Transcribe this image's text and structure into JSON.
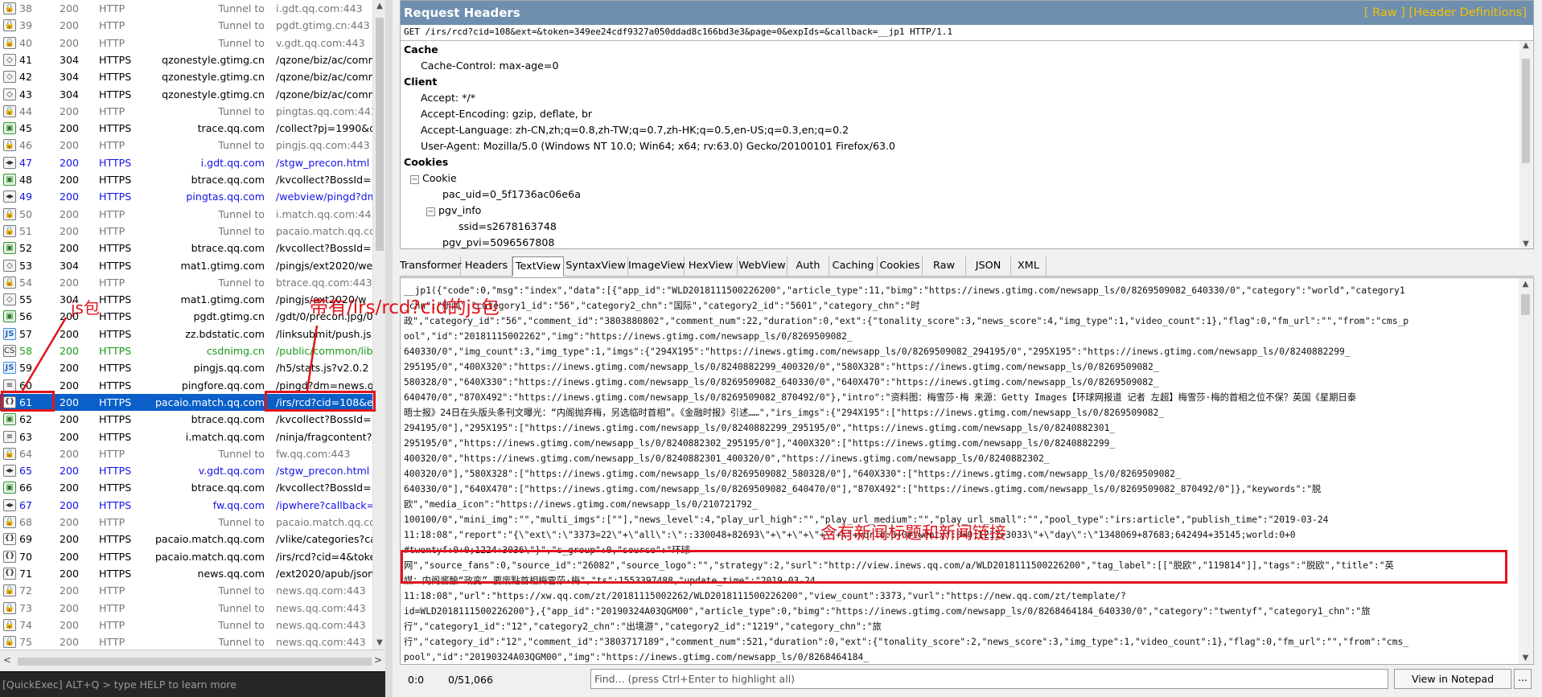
{
  "sessions": [
    {
      "num": "38",
      "result": "200",
      "protocol": "HTTP",
      "host": "Tunnel to",
      "url": "i.gdt.qq.com:443",
      "style": "tunnel",
      "icon": "lock"
    },
    {
      "num": "39",
      "result": "200",
      "protocol": "HTTP",
      "host": "Tunnel to",
      "url": "pgdt.gtimg.cn:443",
      "style": "tunnel",
      "icon": "lock"
    },
    {
      "num": "40",
      "result": "200",
      "protocol": "HTTP",
      "host": "Tunnel to",
      "url": "v.gdt.qq.com:443",
      "style": "tunnel",
      "icon": "lock"
    },
    {
      "num": "41",
      "result": "304",
      "protocol": "HTTPS",
      "host": "qzonestyle.gtimg.cn",
      "url": "/qzone/biz/ac/comm",
      "style": "https",
      "icon": "diamond"
    },
    {
      "num": "42",
      "result": "304",
      "protocol": "HTTPS",
      "host": "qzonestyle.gtimg.cn",
      "url": "/qzone/biz/ac/comm",
      "style": "https",
      "icon": "diamond"
    },
    {
      "num": "43",
      "result": "304",
      "protocol": "HTTPS",
      "host": "qzonestyle.gtimg.cn",
      "url": "/qzone/biz/ac/comm",
      "style": "https",
      "icon": "diamond"
    },
    {
      "num": "44",
      "result": "200",
      "protocol": "HTTP",
      "host": "Tunnel to",
      "url": "pingtas.qq.com:443",
      "style": "tunnel",
      "icon": "lock"
    },
    {
      "num": "45",
      "result": "200",
      "protocol": "HTTPS",
      "host": "trace.qq.com",
      "url": "/collect?pj=1990&d",
      "style": "https",
      "icon": "img"
    },
    {
      "num": "46",
      "result": "200",
      "protocol": "HTTP",
      "host": "Tunnel to",
      "url": "pingjs.qq.com:443",
      "style": "tunnel",
      "icon": "lock"
    },
    {
      "num": "47",
      "result": "200",
      "protocol": "HTTPS",
      "host": "i.gdt.qq.com",
      "url": "/stgw_precon.html",
      "style": "blue",
      "icon": "html"
    },
    {
      "num": "48",
      "result": "200",
      "protocol": "HTTPS",
      "host": "btrace.qq.com",
      "url": "/kvcollect?BossId=1",
      "style": "https",
      "icon": "img"
    },
    {
      "num": "49",
      "result": "200",
      "protocol": "HTTPS",
      "host": "pingtas.qq.com",
      "url": "/webview/pingd?dm",
      "style": "blue",
      "icon": "html"
    },
    {
      "num": "50",
      "result": "200",
      "protocol": "HTTP",
      "host": "Tunnel to",
      "url": "i.match.qq.com:443",
      "style": "tunnel",
      "icon": "lock"
    },
    {
      "num": "51",
      "result": "200",
      "protocol": "HTTP",
      "host": "Tunnel to",
      "url": "pacaio.match.qq.com",
      "style": "tunnel",
      "icon": "lock"
    },
    {
      "num": "52",
      "result": "200",
      "protocol": "HTTPS",
      "host": "btrace.qq.com",
      "url": "/kvcollect?BossId=1",
      "style": "https",
      "icon": "img"
    },
    {
      "num": "53",
      "result": "304",
      "protocol": "HTTPS",
      "host": "mat1.gtimg.com",
      "url": "/pingjs/ext2020/we",
      "style": "https",
      "icon": "diamond"
    },
    {
      "num": "54",
      "result": "200",
      "protocol": "HTTP",
      "host": "Tunnel to",
      "url": "btrace.qq.com:443",
      "style": "tunnel",
      "icon": "lock"
    },
    {
      "num": "55",
      "result": "304",
      "protocol": "HTTPS",
      "host": "mat1.gtimg.com",
      "url": "/pingjs/ext2020/w",
      "style": "https",
      "icon": "diamond"
    },
    {
      "num": "56",
      "result": "200",
      "protocol": "HTTPS",
      "host": "pgdt.gtimg.cn",
      "url": "/gdt/0/precon.jpg/0",
      "style": "https",
      "icon": "img"
    },
    {
      "num": "57",
      "result": "200",
      "protocol": "HTTPS",
      "host": "zz.bdstatic.com",
      "url": "/linksubmit/push.js",
      "style": "https",
      "icon": "js"
    },
    {
      "num": "58",
      "result": "200",
      "protocol": "HTTPS",
      "host": "csdnimg.cn",
      "url": "/public/common/libs",
      "style": "green",
      "icon": "css"
    },
    {
      "num": "59",
      "result": "200",
      "protocol": "HTTPS",
      "host": "pingjs.qq.com",
      "url": "/h5/stats.js?v2.0.2",
      "style": "https",
      "icon": "js"
    },
    {
      "num": "60",
      "result": "200",
      "protocol": "HTTPS",
      "host": "pingfore.qq.com",
      "url": "/pingd?dm=news.qq",
      "style": "https",
      "icon": "doc"
    },
    {
      "num": "61",
      "result": "200",
      "protocol": "HTTPS",
      "host": "pacaio.match.qq.com",
      "url": "/irs/rcd?cid=108&ex",
      "style": "sel",
      "icon": "json"
    },
    {
      "num": "62",
      "result": "200",
      "protocol": "HTTPS",
      "host": "btrace.qq.com",
      "url": "/kvcollect?BossId=1",
      "style": "https",
      "icon": "img"
    },
    {
      "num": "63",
      "result": "200",
      "protocol": "HTTPS",
      "host": "i.match.qq.com",
      "url": "/ninja/fragcontent?",
      "style": "https",
      "icon": "doc"
    },
    {
      "num": "64",
      "result": "200",
      "protocol": "HTTP",
      "host": "Tunnel to",
      "url": "fw.qq.com:443",
      "style": "tunnel",
      "icon": "lock"
    },
    {
      "num": "65",
      "result": "200",
      "protocol": "HTTPS",
      "host": "v.gdt.qq.com",
      "url": "/stgw_precon.html",
      "style": "blue",
      "icon": "html"
    },
    {
      "num": "66",
      "result": "200",
      "protocol": "HTTPS",
      "host": "btrace.qq.com",
      "url": "/kvcollect?BossId=1",
      "style": "https",
      "icon": "img"
    },
    {
      "num": "67",
      "result": "200",
      "protocol": "HTTPS",
      "host": "fw.qq.com",
      "url": "/ipwhere?callback=i",
      "style": "blue",
      "icon": "html"
    },
    {
      "num": "68",
      "result": "200",
      "protocol": "HTTP",
      "host": "Tunnel to",
      "url": "pacaio.match.qq.com",
      "style": "tunnel",
      "icon": "lock"
    },
    {
      "num": "69",
      "result": "200",
      "protocol": "HTTPS",
      "host": "pacaio.match.qq.com",
      "url": "/vlike/categories?ca",
      "style": "https",
      "icon": "json"
    },
    {
      "num": "70",
      "result": "200",
      "protocol": "HTTPS",
      "host": "pacaio.match.qq.com",
      "url": "/irs/rcd?cid=4&toke",
      "style": "https",
      "icon": "json"
    },
    {
      "num": "71",
      "result": "200",
      "protocol": "HTTPS",
      "host": "news.qq.com",
      "url": "/ext2020/apub/json",
      "style": "https",
      "icon": "json"
    },
    {
      "num": "72",
      "result": "200",
      "protocol": "HTTP",
      "host": "Tunnel to",
      "url": "news.qq.com:443",
      "style": "tunnel",
      "icon": "lock"
    },
    {
      "num": "73",
      "result": "200",
      "protocol": "HTTP",
      "host": "Tunnel to",
      "url": "news.qq.com:443",
      "style": "tunnel",
      "icon": "lock"
    },
    {
      "num": "74",
      "result": "200",
      "protocol": "HTTP",
      "host": "Tunnel to",
      "url": "news.qq.com:443",
      "style": "tunnel",
      "icon": "lock"
    },
    {
      "num": "75",
      "result": "200",
      "protocol": "HTTP",
      "host": "Tunnel to",
      "url": "news.qq.com:443",
      "style": "tunnel",
      "icon": "lock"
    }
  ],
  "quickexec": "[QuickExec] ALT+Q > type HELP to learn more",
  "request_headers": {
    "title": "Request Headers",
    "links": "[ Raw ]   [Header Definitions]",
    "request_line": "GET /irs/rcd?cid=108&ext=&token=349ee24cdf9327a050ddad8c166bd3e3&page=0&expIds=&callback=__jp1 HTTP/1.1",
    "cache_title": "Cache",
    "cache_control": "Cache-Control: max-age=0",
    "client_title": "Client",
    "accept": "Accept: */*",
    "accept_encoding": "Accept-Encoding: gzip, deflate, br",
    "accept_language": "Accept-Language: zh-CN,zh;q=0.8,zh-TW;q=0.7,zh-HK;q=0.5,en-US;q=0.3,en;q=0.2",
    "user_agent": "User-Agent: Mozilla/5.0 (Windows NT 10.0; Win64; x64; rv:63.0) Gecko/20100101 Firefox/63.0",
    "cookies_title": "Cookies",
    "cookie_node": "Cookie",
    "pac_uid": "pac_uid=0_5f1736ac06e6a",
    "pgv_info": "pgv_info",
    "ssid": "ssid=s2678163748",
    "pgv_pvi": "pgv_pvi=5096567808"
  },
  "response_tabs": [
    "Transformer",
    "Headers",
    "TextView",
    "SyntaxView",
    "ImageView",
    "HexView",
    "WebView",
    "Auth",
    "Caching",
    "Cookies",
    "Raw",
    "JSON",
    "XML"
  ],
  "active_tab": "TextView",
  "response_lines": [
    "__jp1({\"code\":0,\"msg\":\"index\",\"data\":[{\"app_id\":\"WLD2018111500226200\",\"article_type\":11,\"bimg\":\"https://inews.gtimg.com/newsapp_ls/0/8269509082_640330/0\",\"category\":\"world\",\"category1",
    "_chn\":\"新闻\",\"category1_id\":\"56\",\"category2_chn\":\"国际\",\"category2_id\":\"5601\",\"category_chn\":\"时",
    "政\",\"category_id\":\"56\",\"comment_id\":\"3803880802\",\"comment_num\":22,\"duration\":0,\"ext\":{\"tonality_score\":3,\"news_score\":4,\"img_type\":1,\"video_count\":1},\"flag\":0,\"fm_url\":\"\",\"from\":\"cms_p",
    "ool\",\"id\":\"20181115002262\",\"img\":\"https://inews.gtimg.com/newsapp_ls/0/8269509082_",
    "640330/0\",\"img_count\":3,\"img_type\":1,\"imgs\":{\"294X195\":\"https://inews.gtimg.com/newsapp_ls/0/8269509082_294195/0\",\"295X195\":\"https://inews.gtimg.com/newsapp_ls/0/8240882299_",
    "295195/0\",\"400X320\":\"https://inews.gtimg.com/newsapp_ls/0/8240882299_400320/0\",\"580X328\":\"https://inews.gtimg.com/newsapp_ls/0/8269509082_",
    "580328/0\",\"640X330\":\"https://inews.gtimg.com/newsapp_ls/0/8269509082_640330/0\",\"640X470\":\"https://inews.gtimg.com/newsapp_ls/0/8269509082_",
    "640470/0\",\"870X492\":\"https://inews.gtimg.com/newsapp_ls/0/8269509082_870492/0\"},\"intro\":\"资料图：梅雪莎·梅 来源：Getty Images【环球网报道 记者 左超】梅雪莎·梅的首相之位不保？英国《星期日泰",
    "晤士报》24日在头版头条刊文曝光：“内阁抛弃梅，另选临时首相”。《金融时报》引述……\",\"irs_imgs\":{\"294X195\":[\"https://inews.gtimg.com/newsapp_ls/0/8269509082_",
    "294195/0\"],\"295X195\":[\"https://inews.gtimg.com/newsapp_ls/0/8240882299_295195/0\",\"https://inews.gtimg.com/newsapp_ls/0/8240882301_",
    "295195/0\",\"https://inews.gtimg.com/newsapp_ls/0/8240882302_295195/0\"],\"400X320\":[\"https://inews.gtimg.com/newsapp_ls/0/8240882299_",
    "400320/0\",\"https://inews.gtimg.com/newsapp_ls/0/8240882301_400320/0\",\"https://inews.gtimg.com/newsapp_ls/0/8240882302_",
    "400320/0\"],\"580X328\":[\"https://inews.gtimg.com/newsapp_ls/0/8269509082_580328/0\"],\"640X330\":[\"https://inews.gtimg.com/newsapp_ls/0/8269509082_",
    "640330/0\"],\"640X470\":[\"https://inews.gtimg.com/newsapp_ls/0/8269509082_640470/0\"],\"870X492\":[\"https://inews.gtimg.com/newsapp_ls/0/8269509082_870492/0\"]},\"keywords\":\"脱",
    "欧\",\"media_icon\":\"https://inews.gtimg.com/newsapp_ls/0/210721792_",
    "100100/0\",\"mini_img\":\"\",\"multi_imgs\":[\"\"],\"news_level\":4,\"play_url_high\":\"\",\"play_url_medium\":\"\",\"play_url_small\":\"\",\"pool_type\":\"irs:article\",\"publish_time\":\"2019-03-24",
    "11:18:08\",\"report\":\"{\\\"ext\\\":\\\"3373=22\\\"+\\\"all\\\":\\\"::330048+82693\\\"+\\\"+\\\"+\\\"+\\\"+\\\"+world:0+0#twentyf:0+0;1211+3033\\\"+\\\"day\\\":\\\"1348069+87683;642494+35145;world:0+0",
    "#twentyf:0+0;1224+3036\\\"}\",\"s_group\":0,\"source\":\"环球",
    "网\",\"source_fans\":0,\"source_id\":\"26082\",\"source_logo\":\"\",\"strategy\":2,\"surl\":\"http://view.inews.qq.com/a/WLD2018111500226200\",\"tag_label\":[[\"脱欧\",\"119814\"]],\"tags\":\"脱欧\",\"title\":\"英",
    "媒：内阁酱酿“政变” 要废點首相梅雪莎·梅\",\"ts\":1553397488,\"update_time\":\"2019-03-24",
    "11:18:08\",\"url\":\"https://xw.qq.com/zt/20181115002262/WLD2018111500226200\",\"view_count\":3373,\"vurl\":\"https://new.qq.com/zt/template/?",
    "id=WLD2018111500226200\"},{\"app_id\":\"20190324A03QGM00\",\"article_type\":0,\"bimg\":\"https://inews.gtimg.com/newsapp_ls/0/8268464184_640330/0\",\"category\":\"twentyf\",\"category1_chn\":\"旅",
    "行\",\"category1_id\":\"12\",\"category2_chn\":\"出境游\",\"category2_id\":\"1219\",\"category_chn\":\"旅",
    "行\",\"category_id\":\"12\",\"comment_id\":\"3803717189\",\"comment_num\":521,\"duration\":0,\"ext\":{\"tonality_score\":2,\"news_score\":3,\"img_type\":1,\"video_count\":1},\"flag\":0,\"fm_url\":\"\",\"from\":\"cms_",
    "pool\",\"id\":\"20190324A03QGM00\",\"img\":\"https://inews.gtimg.com/newsapp_ls/0/8268464184_"
  ],
  "status": {
    "pos": "0:0",
    "count": "0/51,066",
    "find_placeholder": "Find... (press Ctrl+Enter to highlight all)",
    "notepad": "View in Notepad",
    "more": "..."
  },
  "annotations": {
    "js_label": "js包",
    "irs_label": "带有/irs/rcd?cid的js包",
    "news_label": "含有新闻标题和新闻链接"
  },
  "colors": {
    "accent_red": "#e0141c",
    "selection": "#0a5fc8",
    "header_bar": "#6f8fb0",
    "header_links": "#f2c300"
  }
}
